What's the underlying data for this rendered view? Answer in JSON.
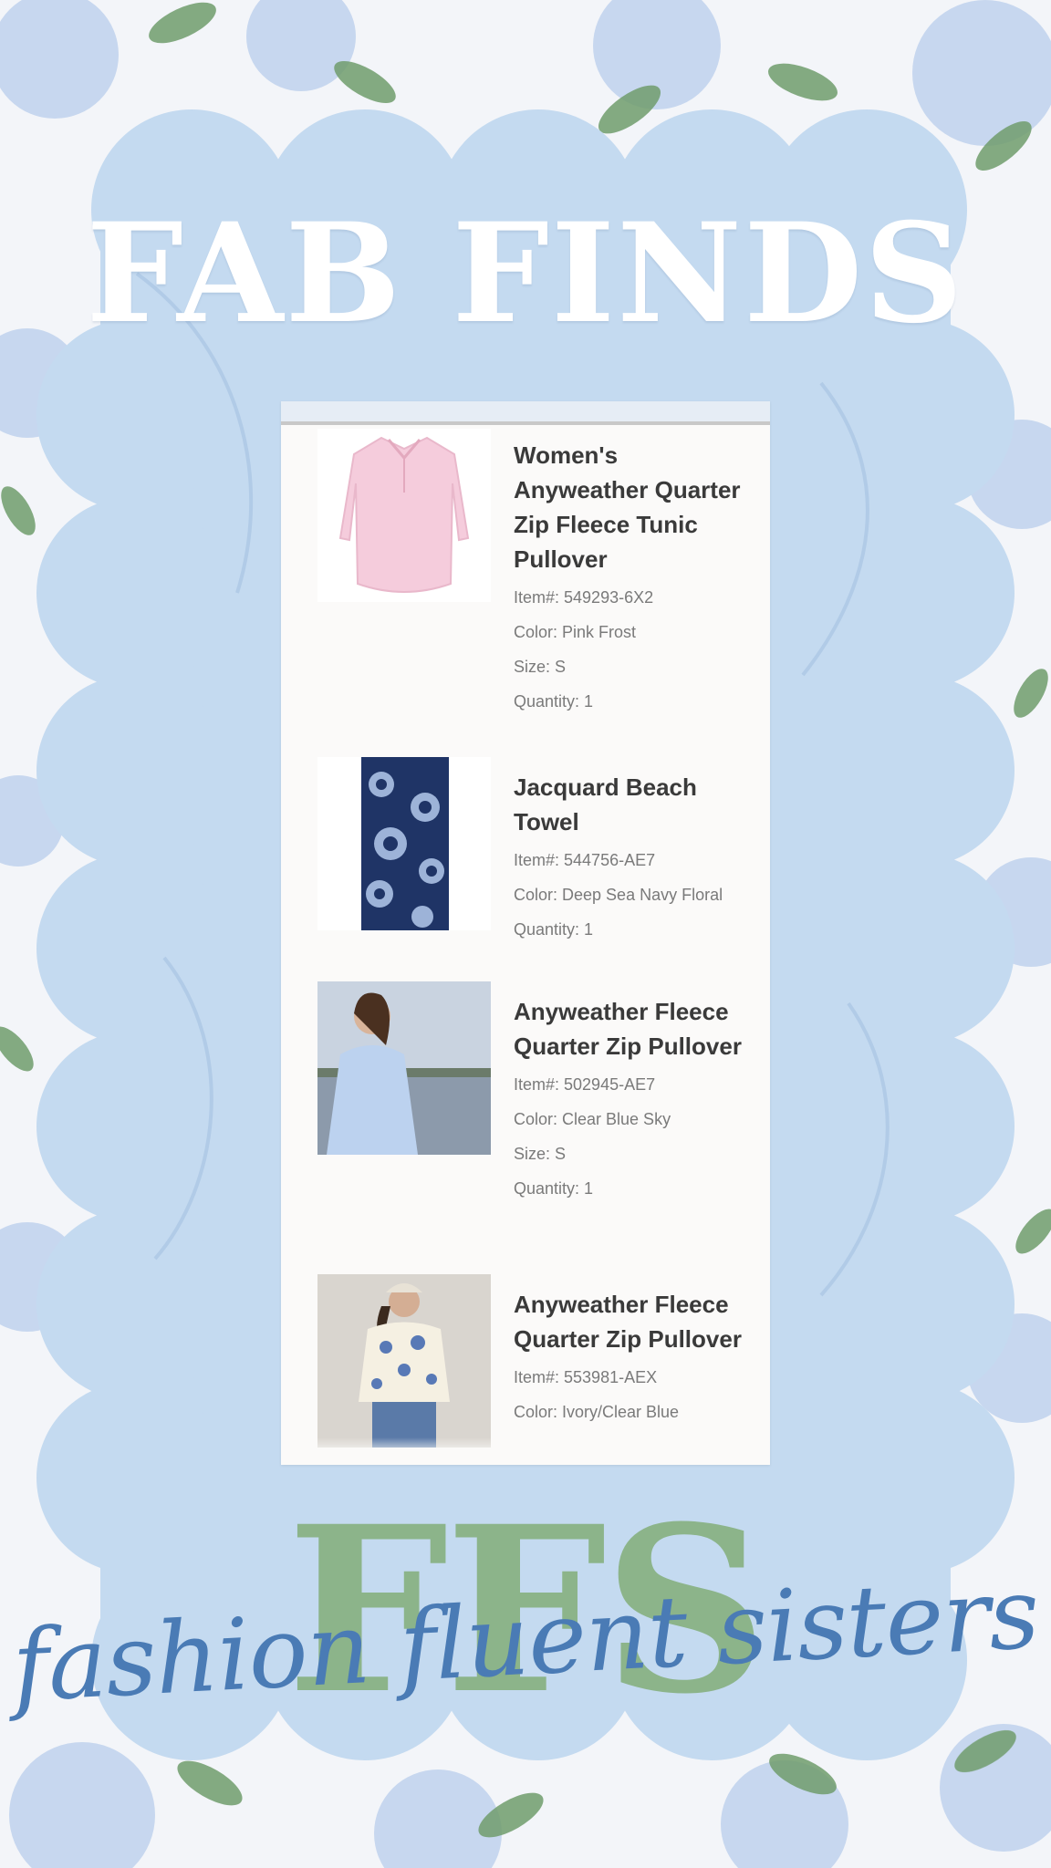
{
  "header": {
    "title": "FAB FINDS"
  },
  "order": {
    "items": [
      {
        "name": "Women's Anyweather Quarter Zip Fleece Tunic Pullover",
        "item_number": "Item#: 549293-6X2",
        "color": "Color: Pink Frost",
        "size": "Size: S",
        "quantity": "Quantity: 1",
        "image": "pink-pullover-photo"
      },
      {
        "name": "Jacquard Beach Towel",
        "item_number": "Item#: 544756-AE7",
        "color": "Color: Deep Sea Navy Floral",
        "quantity": "Quantity: 1",
        "image": "navy-floral-towel-photo"
      },
      {
        "name": "Anyweather Fleece Quarter Zip Pullover",
        "item_number": "Item#: 502945-AE7",
        "color": "Color: Clear Blue Sky",
        "size": "Size: S",
        "quantity": "Quantity: 1",
        "image": "blue-pullover-model-photo"
      },
      {
        "name": "Anyweather Fleece Quarter Zip Pullover",
        "item_number": "Item#: 553981-AEX",
        "color": "Color: Ivory/Clear Blue",
        "image": "ivory-floral-pullover-model-photo"
      }
    ]
  },
  "footer": {
    "logo_mark": "FFS",
    "tagline": "fashion fluent sisters"
  },
  "colors": {
    "scallop_blue": "#c4daf0",
    "logo_green": "#8cb48a",
    "tagline_blue": "#4a7bb5",
    "card_background": "#fbfaf9"
  }
}
